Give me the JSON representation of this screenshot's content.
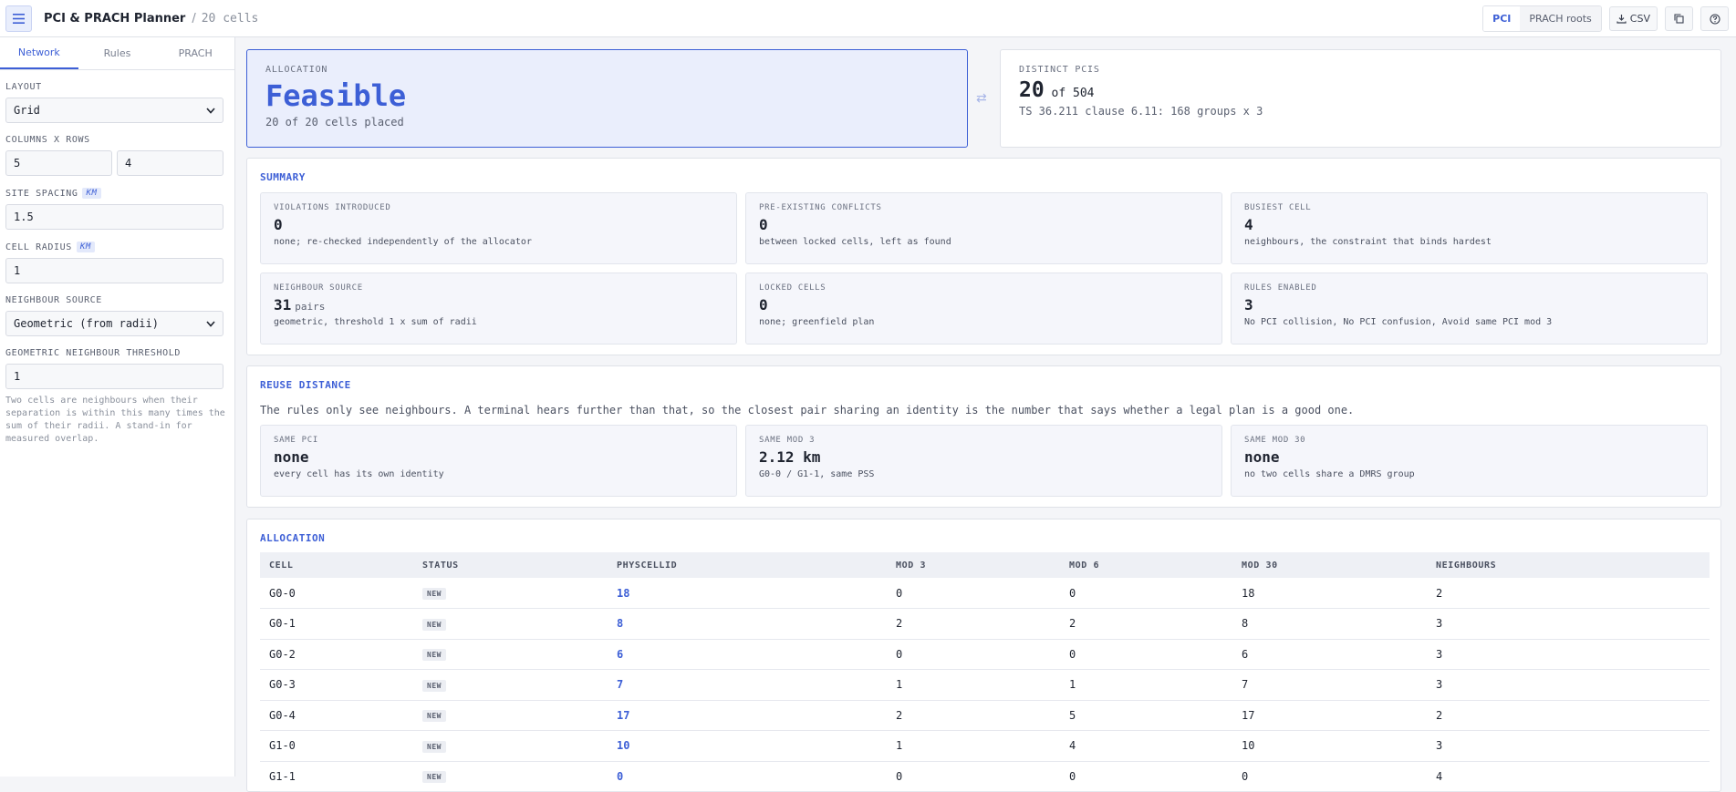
{
  "header": {
    "title": "PCI & PRACH Planner",
    "separator": "/",
    "cells_label": "20 cells",
    "modes": [
      "PCI",
      "PRACH roots"
    ],
    "csv_label": "CSV"
  },
  "sidebar": {
    "tabs": [
      "Network",
      "Rules",
      "PRACH"
    ],
    "layout_label": "LAYOUT",
    "layout_value": "Grid",
    "cols_rows_label": "COLUMNS X ROWS",
    "cols_value": "5",
    "rows_value": "4",
    "spacing_label": "SITE SPACING",
    "spacing_unit": "KM",
    "spacing_value": "1.5",
    "radius_label": "CELL RADIUS",
    "radius_unit": "KM",
    "radius_value": "1",
    "neighbour_source_label": "NEIGHBOUR SOURCE",
    "neighbour_source_value": "Geometric (from radii)",
    "threshold_label": "GEOMETRIC NEIGHBOUR THRESHOLD",
    "threshold_value": "1",
    "hint": "Two cells are neighbours when their separation is within this many times the sum of their radii. A stand-in for measured overlap."
  },
  "allocation_hero": {
    "kicker": "ALLOCATION",
    "status": "Feasible",
    "sub": "20 of 20 cells placed"
  },
  "distinct_hero": {
    "kicker": "DISTINCT PCIS",
    "count": "20",
    "of_text": "of 504",
    "sub": "TS 36.211 clause 6.11: 168 groups x 3"
  },
  "summary": {
    "title": "SUMMARY",
    "cards": [
      {
        "kicker": "VIOLATIONS INTRODUCED",
        "value": "0",
        "unit": "",
        "note": "none; re-checked independently of the allocator"
      },
      {
        "kicker": "PRE-EXISTING CONFLICTS",
        "value": "0",
        "unit": "",
        "note": "between locked cells, left as found"
      },
      {
        "kicker": "BUSIEST CELL",
        "value": "4",
        "unit": "",
        "note": "neighbours, the constraint that binds hardest"
      },
      {
        "kicker": "NEIGHBOUR SOURCE",
        "value": "31",
        "unit": "pairs",
        "note": "geometric, threshold 1 x sum of radii"
      },
      {
        "kicker": "LOCKED CELLS",
        "value": "0",
        "unit": "",
        "note": "none; greenfield plan"
      },
      {
        "kicker": "RULES ENABLED",
        "value": "3",
        "unit": "",
        "note": "No PCI collision, No PCI confusion, Avoid same PCI mod 3"
      }
    ]
  },
  "reuse": {
    "title": "REUSE DISTANCE",
    "desc": "The rules only see neighbours. A terminal hears further than that, so the closest pair sharing an identity is the number that says whether a legal plan is a good one.",
    "cards": [
      {
        "kicker": "SAME PCI",
        "value": "none",
        "note": "every cell has its own identity"
      },
      {
        "kicker": "SAME MOD 3",
        "value": "2.12 km",
        "note": "G0-0 / G1-1, same PSS"
      },
      {
        "kicker": "SAME MOD 30",
        "value": "none",
        "note": "no two cells share a DMRS group"
      }
    ]
  },
  "allocation_table": {
    "title": "ALLOCATION",
    "headers": [
      "CELL",
      "STATUS",
      "PHYSCELLID",
      "MOD 3",
      "MOD 6",
      "MOD 30",
      "NEIGHBOURS"
    ],
    "rows": [
      {
        "cell": "G0-0",
        "status": "NEW",
        "pci": "18",
        "mod3": "0",
        "mod6": "0",
        "mod30": "18",
        "neighbours": "2"
      },
      {
        "cell": "G0-1",
        "status": "NEW",
        "pci": "8",
        "mod3": "2",
        "mod6": "2",
        "mod30": "8",
        "neighbours": "3"
      },
      {
        "cell": "G0-2",
        "status": "NEW",
        "pci": "6",
        "mod3": "0",
        "mod6": "0",
        "mod30": "6",
        "neighbours": "3"
      },
      {
        "cell": "G0-3",
        "status": "NEW",
        "pci": "7",
        "mod3": "1",
        "mod6": "1",
        "mod30": "7",
        "neighbours": "3"
      },
      {
        "cell": "G0-4",
        "status": "NEW",
        "pci": "17",
        "mod3": "2",
        "mod6": "5",
        "mod30": "17",
        "neighbours": "2"
      },
      {
        "cell": "G1-0",
        "status": "NEW",
        "pci": "10",
        "mod3": "1",
        "mod6": "4",
        "mod30": "10",
        "neighbours": "3"
      },
      {
        "cell": "G1-1",
        "status": "NEW",
        "pci": "0",
        "mod3": "0",
        "mod6": "0",
        "mod30": "0",
        "neighbours": "4"
      }
    ]
  }
}
